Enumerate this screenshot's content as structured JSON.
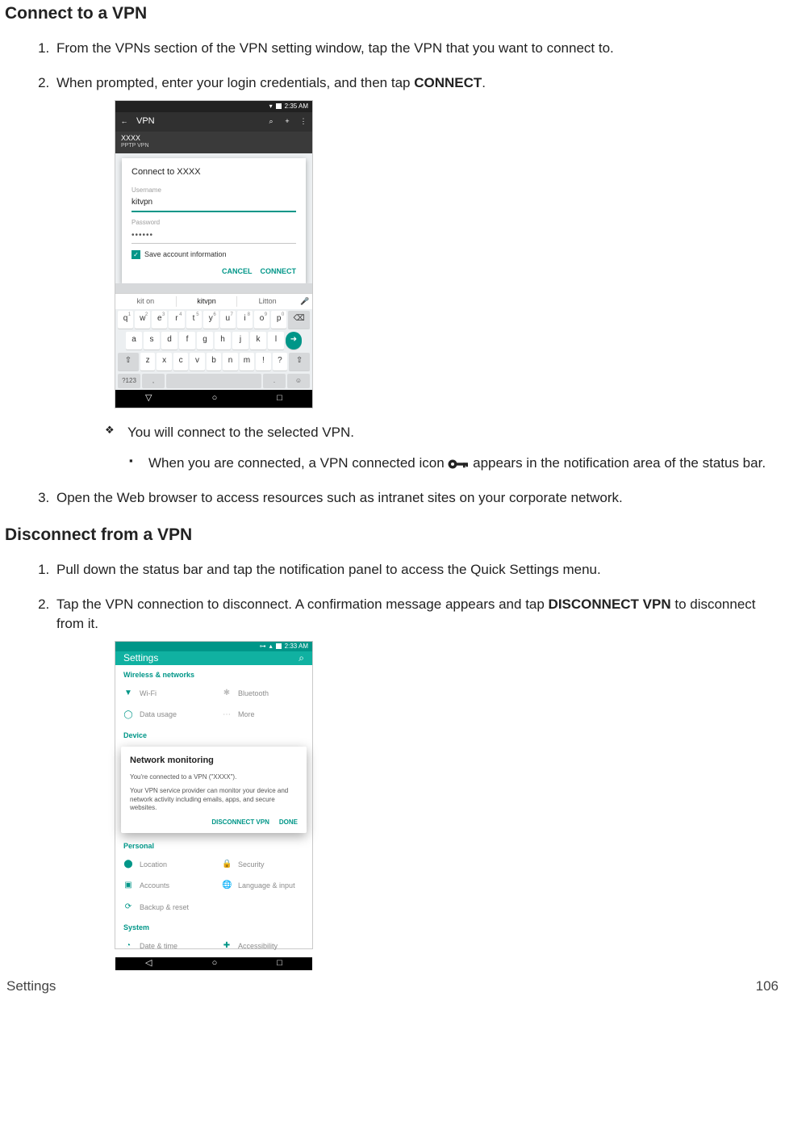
{
  "section1": {
    "title": "Connect to a VPN",
    "steps": [
      "From the VPNs section of the VPN setting window, tap the VPN that you want to connect to.",
      {
        "pre": "When prompted, enter your login credentials, and then tap ",
        "bold": "CONNECT",
        "post": "."
      },
      "Open the Web browser to access resources such as intranet sites on your corporate network."
    ],
    "bullet_diamond": "You will connect to the selected VPN.",
    "bullet_square": {
      "pre": "When you are connected, a VPN connected icon ",
      "post": " appears in the notification area of the status bar."
    }
  },
  "section2": {
    "title": "Disconnect from a VPN",
    "steps": [
      "Pull down the status bar and tap the notification panel to access the Quick Settings menu.",
      {
        "pre": "Tap the VPN connection to disconnect. A confirmation message appears and tap ",
        "bold": "DISCONNECT VPN",
        "post": " to disconnect from it."
      }
    ]
  },
  "phone1": {
    "status_time": "2:35 AM",
    "appbar_title": "VPN",
    "sub_name": "XXXX",
    "sub_type": "PPTP VPN",
    "dialog_title": "Connect to XXXX",
    "username_label": "Username",
    "username_value": "kitvpn",
    "password_label": "Password",
    "password_value": "••••••",
    "checkbox_label": "Save account information",
    "btn_cancel": "CANCEL",
    "btn_connect": "CONNECT",
    "suggest": [
      "kit on",
      "kitvpn",
      "Litton"
    ],
    "kb_sym": "?123"
  },
  "phone2": {
    "status_time": "2:33 AM",
    "appbar_title": "Settings",
    "sh_wireless": "Wireless & networks",
    "wifi": "Wi-Fi",
    "bluetooth": "Bluetooth",
    "datausage": "Data usage",
    "more": "More",
    "sh_device": "Device",
    "dlg_title": "Network monitoring",
    "dlg_p1": "You're connected to a VPN (\"XXXX\").",
    "dlg_p2": "Your VPN service provider can monitor your device and network activity including emails, apps, and secure websites.",
    "btn_disconnect": "DISCONNECT VPN",
    "btn_done": "DONE",
    "sh_personal": "Personal",
    "location": "Location",
    "security": "Security",
    "accounts": "Accounts",
    "lang": "Language & input",
    "backup": "Backup & reset",
    "sh_system": "System",
    "datetime": "Date & time",
    "access": "Accessibility"
  },
  "footer": {
    "left": "Settings",
    "right": "106"
  }
}
